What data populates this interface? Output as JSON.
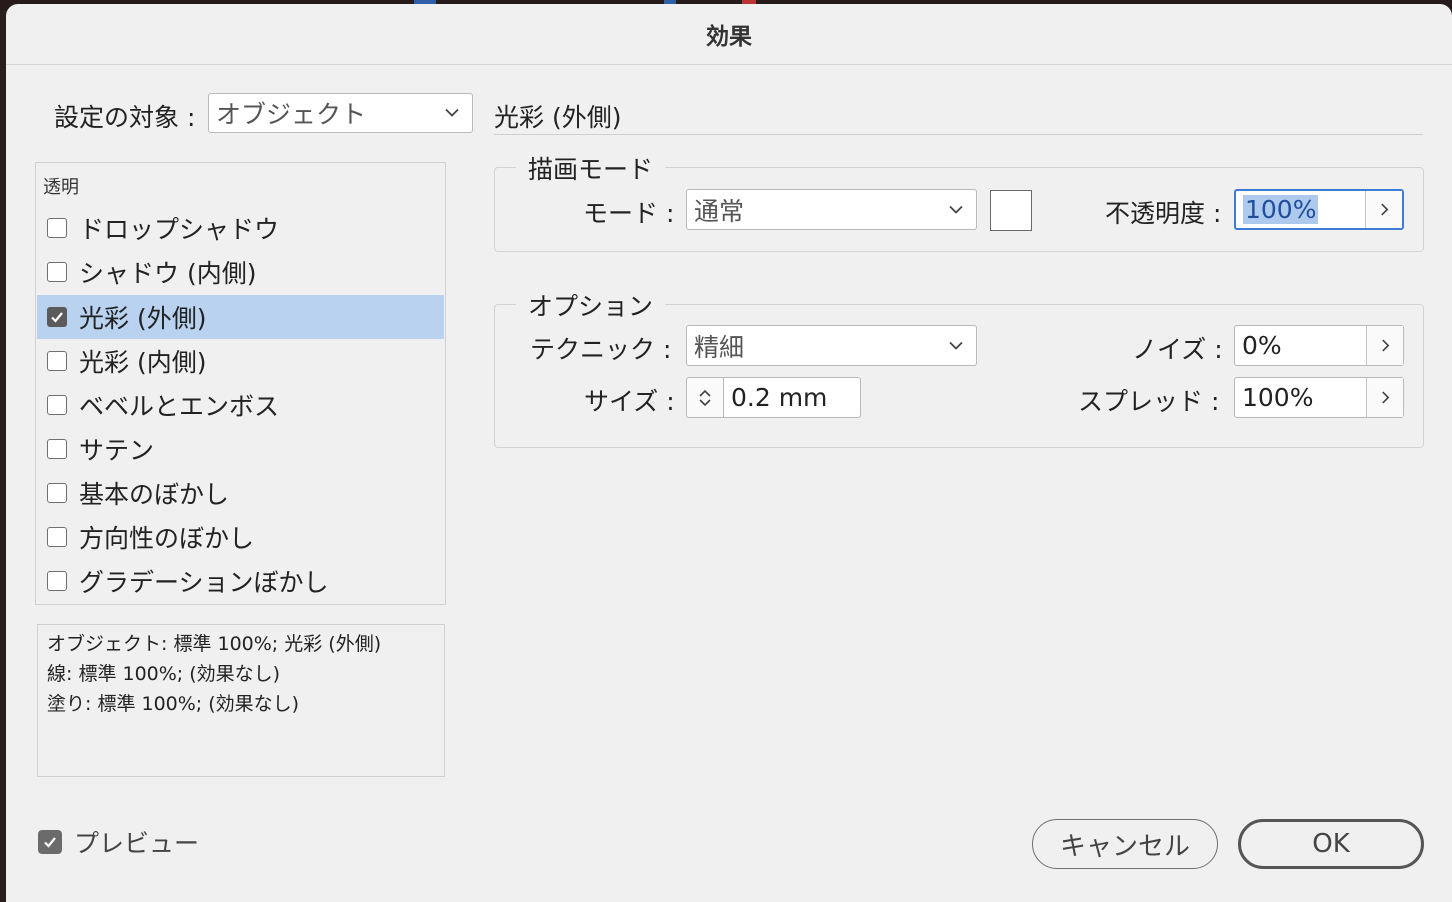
{
  "dialog": {
    "title": "効果"
  },
  "target": {
    "label": "設定の対象 :",
    "value": "オブジェクト"
  },
  "panel": {
    "heading": "光彩 (外側)"
  },
  "list": {
    "category": "透明",
    "items": [
      {
        "label": "ドロップシャドウ",
        "checked": false,
        "selected": false
      },
      {
        "label": "シャドウ (内側)",
        "checked": false,
        "selected": false
      },
      {
        "label": "光彩 (外側)",
        "checked": true,
        "selected": true
      },
      {
        "label": "光彩 (内側)",
        "checked": false,
        "selected": false
      },
      {
        "label": "ベベルとエンボス",
        "checked": false,
        "selected": false
      },
      {
        "label": "サテン",
        "checked": false,
        "selected": false
      },
      {
        "label": "基本のぼかし",
        "checked": false,
        "selected": false
      },
      {
        "label": "方向性のぼかし",
        "checked": false,
        "selected": false
      },
      {
        "label": "グラデーションぼかし",
        "checked": false,
        "selected": false
      }
    ]
  },
  "summary": {
    "lines": [
      "オブジェクト: 標準 100%; 光彩 (外側)",
      "線: 標準 100%; (効果なし)",
      "塗り: 標準 100%; (効果なし)"
    ]
  },
  "blend": {
    "group_title": "描画モード",
    "mode_label": "モード :",
    "mode_value": "通常",
    "opacity_label": "不透明度 :",
    "opacity_value": "100%"
  },
  "options": {
    "group_title": "オプション",
    "technique_label": "テクニック :",
    "technique_value": "精細",
    "size_label": "サイズ :",
    "size_value": "0.2 mm",
    "noise_label": "ノイズ :",
    "noise_value": "0%",
    "spread_label": "スプレッド :",
    "spread_value": "100%"
  },
  "preview": {
    "label": "プレビュー",
    "checked": true
  },
  "buttons": {
    "cancel": "キャンセル",
    "ok": "OK"
  },
  "colors": {
    "selection": "#b8d2f0",
    "focus_ring": "#3c7bd6",
    "dialog_bg": "#f0f0f0"
  }
}
